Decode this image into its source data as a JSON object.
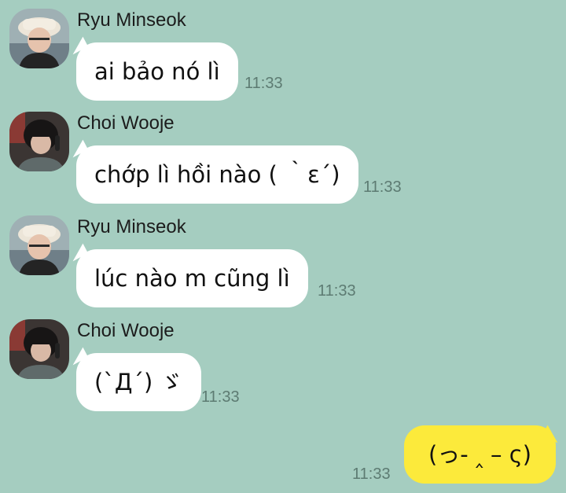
{
  "messages": [
    {
      "sender": "Ryu Minseok",
      "text": "ai bảo nó lì",
      "time": "11:33",
      "avatar_icon": "avatar-ryu-minseok"
    },
    {
      "sender": "Choi Wooje",
      "text": "chớp lì hồi nào ( ｀ε´)",
      "time": "11:33",
      "avatar_icon": "avatar-choi-wooje"
    },
    {
      "sender": "Ryu Minseok",
      "text": "lúc nào m cũng lì",
      "time": "11:33",
      "avatar_icon": "avatar-ryu-minseok"
    },
    {
      "sender": "Choi Wooje",
      "text": "(`Д´) ゞ",
      "time": "11:33",
      "avatar_icon": "avatar-choi-wooje"
    }
  ],
  "my_message": {
    "text": "(っ- ‸ – ς)",
    "time": "11:33"
  },
  "colors": {
    "background": "#a5cdc0",
    "incoming_bubble": "#ffffff",
    "outgoing_bubble": "#fcea3b",
    "time_text": "#5d7b72"
  }
}
